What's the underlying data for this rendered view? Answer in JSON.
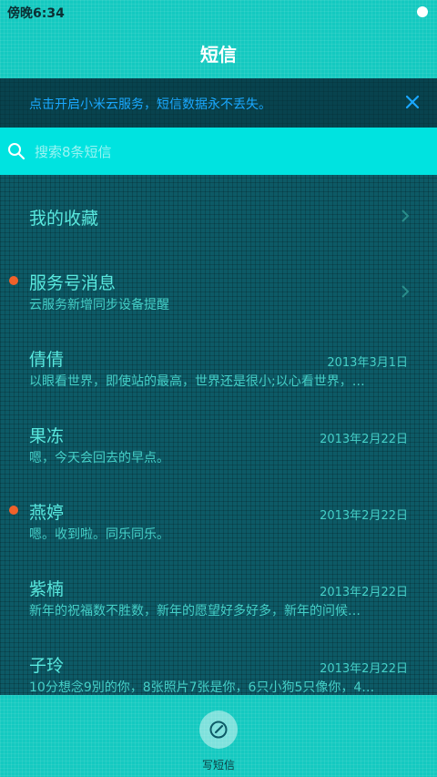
{
  "status": {
    "time": "傍晚6:34"
  },
  "header": {
    "title": "短信"
  },
  "banner": {
    "text": "点击开启小米云服务，短信数据永不丢失。"
  },
  "search": {
    "placeholder": "搜索8条短信"
  },
  "favorites": {
    "label": "我的收藏"
  },
  "service": {
    "name": "服务号消息",
    "preview": "云服务新增同步设备提醒",
    "unread": true
  },
  "conversations": [
    {
      "name": "倩倩",
      "date": "2013年3月1日",
      "preview": "以眼看世界，即使站的最高，世界还是很小;以心看世界，…",
      "unread": false
    },
    {
      "name": "果冻",
      "date": "2013年2月22日",
      "preview": "嗯，今天会回去的早点。",
      "unread": false
    },
    {
      "name": "燕婷",
      "date": "2013年2月22日",
      "preview": "嗯。收到啦。同乐同乐。",
      "unread": true
    },
    {
      "name": "紫楠",
      "date": "2013年2月22日",
      "preview": "新年的祝福数不胜数，新年的愿望好多好多，新年的问候…",
      "unread": false
    },
    {
      "name": "子玲",
      "date": "2013年2月22日",
      "preview": "10分想念9別的你，8张照片7张是你，6只小狗5只像你，4…",
      "unread": false
    }
  ],
  "bottom": {
    "compose_label": "写短信"
  },
  "colors": {
    "accent": "#14c9c0",
    "search_bg": "#00e3e0",
    "banner_text": "#1aa8ff",
    "unread_dot": "#f0612a",
    "list_text": "#59e8de"
  }
}
